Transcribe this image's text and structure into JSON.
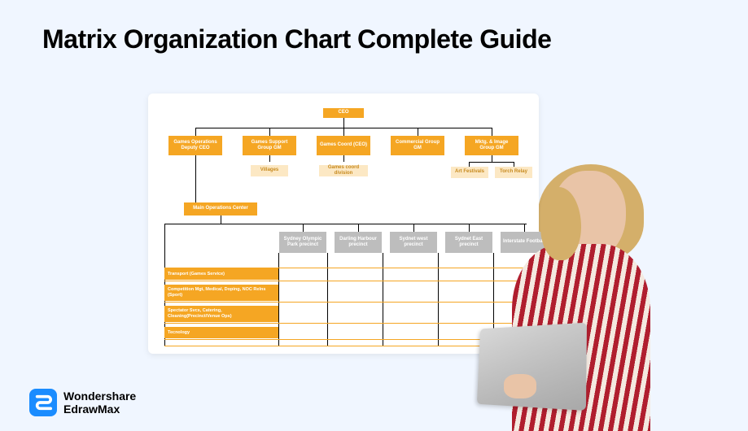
{
  "title": "Matrix Organization Chart  Complete Guide",
  "brand": {
    "line1": "Wondershare",
    "line2": "EdrawMax"
  },
  "chart": {
    "top": "CEO",
    "level2": [
      "Games Operations Deputy CEO",
      "Games Support Group GM",
      "Games Coord (CEO)",
      "Commercial Group GM",
      "Mktg. & Image Group GM"
    ],
    "sub": {
      "villages": "Villages",
      "coord_div": "Games coord division",
      "art": "Art Festivals",
      "torch": "Torch Relay"
    },
    "main_ops": "Main Operations Center",
    "precincts": [
      "Sydney Olympic Park precinct",
      "Darling Harbour precinct",
      "Sydnet west precinct",
      "Sydnet East precinct",
      "Interstate Football"
    ],
    "rows": [
      "Transport (Games Service)",
      "Competition Mgt, Medical, Doping, NOC Relns (Sport)",
      "Spectator Svcs, Catering, Cleaning(Precinct/Venue Ops)",
      "Tecnology"
    ]
  }
}
